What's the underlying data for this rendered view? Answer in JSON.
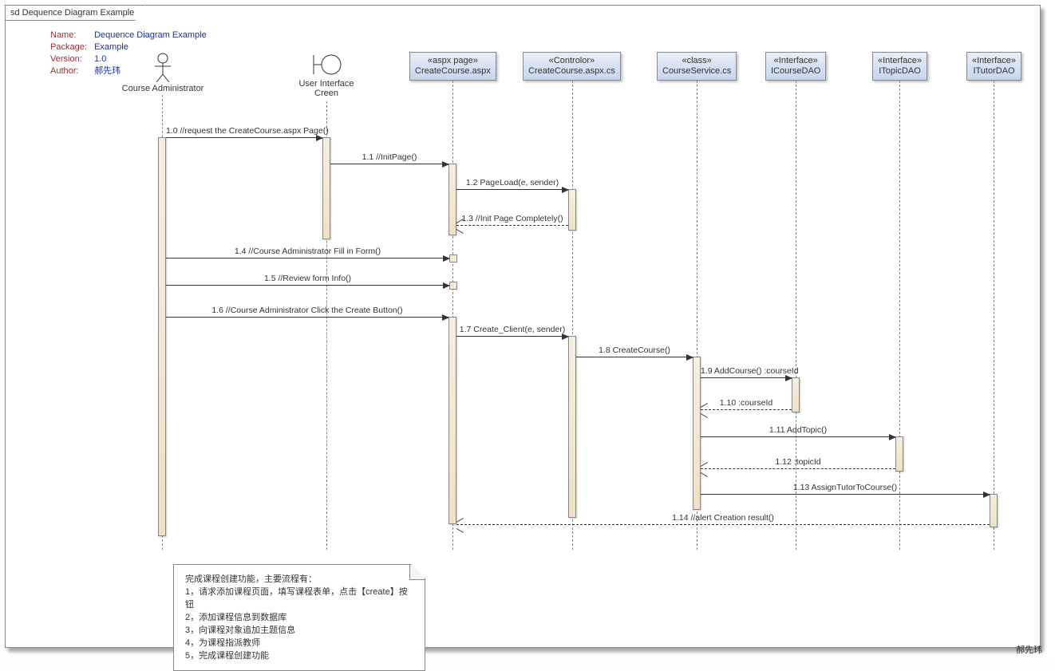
{
  "frame_title": "sd Dequence Diagram Example",
  "metadata": {
    "name_label": "Name:",
    "name_value": "Dequence Diagram Example",
    "package_label": "Package:",
    "package_value": "Example",
    "version_label": "Version:",
    "version_value": "1.0",
    "author_label": "Author:",
    "author_value": "郝先玮"
  },
  "participants": {
    "p0": "Course Administrator",
    "p1": "User Interface Creen",
    "p2_stereo": "«aspx page»",
    "p2_name": "CreateCourse.aspx",
    "p3_stereo": "«Controlor»",
    "p3_name": "CreateCourse.aspx.cs",
    "p4_stereo": "«class»",
    "p4_name": "CourseService.cs",
    "p5_stereo": "«Interface»",
    "p5_name": "ICourseDAO",
    "p6_stereo": "«Interface»",
    "p6_name": "ITopicDAO",
    "p7_stereo": "«Interface»",
    "p7_name": "ITutorDAO"
  },
  "messages": {
    "m1_0": "1.0 //request the CreateCourse.aspx Page()",
    "m1_1": "1.1 //InitPage()",
    "m1_2": "1.2 PageLoad(e, sender)",
    "m1_3": "1.3 //Init Page Completely()",
    "m1_4": "1.4 //Course Administrator Fill in  Form()",
    "m1_5": "1.5 //Review  form Info()",
    "m1_6": "1.6 //Course Administrator Click the Create Button()",
    "m1_7": "1.7 Create_Client(e, sender)",
    "m1_8": "1.8 CreateCourse()",
    "m1_9": "1.9 AddCourse() :courseId",
    "m1_10": "1.10  :courseId",
    "m1_11": "1.11 AddTopic()",
    "m1_12": "1.12  :topicId",
    "m1_13": "1.13 AssignTutorToCourse()",
    "m1_14": "1.14 //alert Creation result()"
  },
  "note": {
    "l0": "完成课程创建功能，主要流程有：",
    "l1": "1，请求添加课程页面，填写课程表单，点击【create】按钮",
    "l2": "2，添加课程信息到数据库",
    "l3": "3，向课程对象追加主题信息",
    "l4": "4，为课程指派教师",
    "l5": "5，完成课程创建功能"
  },
  "watermark": "郝先玮"
}
